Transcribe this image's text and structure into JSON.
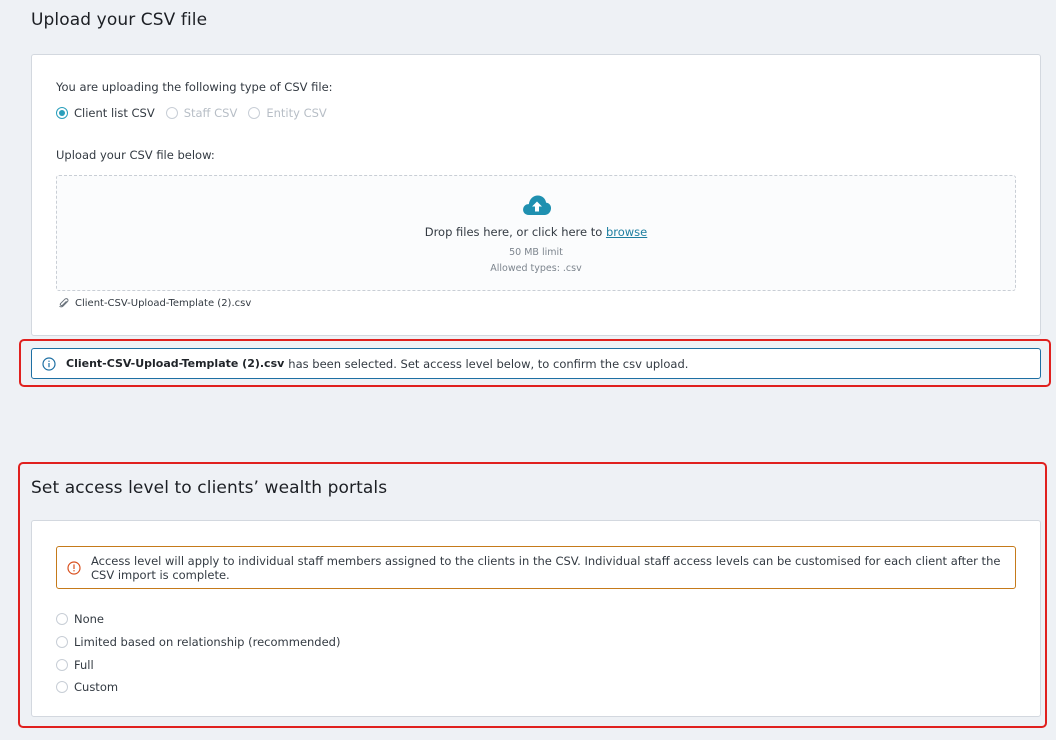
{
  "upload_section": {
    "title": "Upload your CSV file",
    "type_prompt": "You are uploading the following type of CSV file:",
    "csv_types": [
      {
        "label": "Client list CSV",
        "selected": true,
        "disabled": false
      },
      {
        "label": "Staff CSV",
        "selected": false,
        "disabled": true
      },
      {
        "label": "Entity CSV",
        "selected": false,
        "disabled": true
      }
    ],
    "below_prompt": "Upload your CSV file below:",
    "dropzone": {
      "icon": "cloud-upload-icon",
      "text_before": "Drop files here, or click here to ",
      "browse_label": "browse",
      "limit": "50 MB limit",
      "allowed_types": "Allowed types: .csv"
    },
    "attached_file": {
      "icon": "paperclip-icon",
      "name": "Client-CSV-Upload-Template (2).csv"
    }
  },
  "info_banner": {
    "icon": "info-icon",
    "filename": "Client-CSV-Upload-Template (2).csv",
    "message": "has been selected. Set access level below, to confirm the csv upload."
  },
  "access_section": {
    "title": "Set access level to clients’ wealth portals",
    "warning": {
      "icon": "warning-icon",
      "text": "Access level will apply to individual staff members assigned to the clients in the CSV. Individual staff access levels can be customised for each client after the CSV import is complete."
    },
    "options": [
      {
        "label": "None",
        "selected": false
      },
      {
        "label": "Limited based on relationship (recommended)",
        "selected": false
      },
      {
        "label": "Full",
        "selected": false
      },
      {
        "label": "Custom",
        "selected": false
      }
    ]
  },
  "colors": {
    "accent": "#2a9fbc",
    "info_border": "#1d6fa3",
    "warning_border": "#c57a1a",
    "highlight": "#e0201e",
    "background": "#eef1f5"
  }
}
